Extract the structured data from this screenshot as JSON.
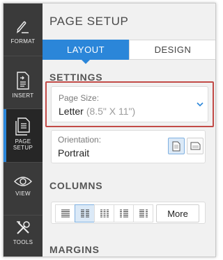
{
  "sidebar": {
    "items": [
      {
        "label": "FORMAT",
        "icon": "format-brush-icon",
        "active": false
      },
      {
        "label": "INSERT",
        "icon": "insert-document-icon",
        "active": false
      },
      {
        "label": "PAGE SETUP",
        "label_line1": "PAGE",
        "label_line2": "SETUP",
        "icon": "page-setup-icon",
        "active": true
      },
      {
        "label": "VIEW",
        "icon": "eye-icon",
        "active": false
      },
      {
        "label": "TOOLS",
        "icon": "tools-icon",
        "active": false
      }
    ]
  },
  "panel": {
    "title": "PAGE SETUP",
    "tabs": [
      {
        "label": "LAYOUT",
        "active": true
      },
      {
        "label": "DESIGN",
        "active": false
      }
    ],
    "settings": {
      "heading": "SETTINGS",
      "page_size": {
        "label": "Page Size:",
        "value": "Letter",
        "dimensions": "(8.5\" X 11\")"
      },
      "orientation": {
        "label": "Orientation:",
        "value": "Portrait",
        "options": [
          "portrait",
          "landscape"
        ],
        "selected": "portrait"
      }
    },
    "columns": {
      "heading": "COLUMNS",
      "options": [
        "one-column",
        "two-column",
        "three-column",
        "left-column",
        "right-column"
      ],
      "selected": "two-column",
      "more_label": "More"
    },
    "margins": {
      "heading": "MARGINS"
    }
  },
  "colors": {
    "accent": "#2b86d9",
    "rail": "#3a3a3a",
    "highlight_border": "#c24a47"
  }
}
